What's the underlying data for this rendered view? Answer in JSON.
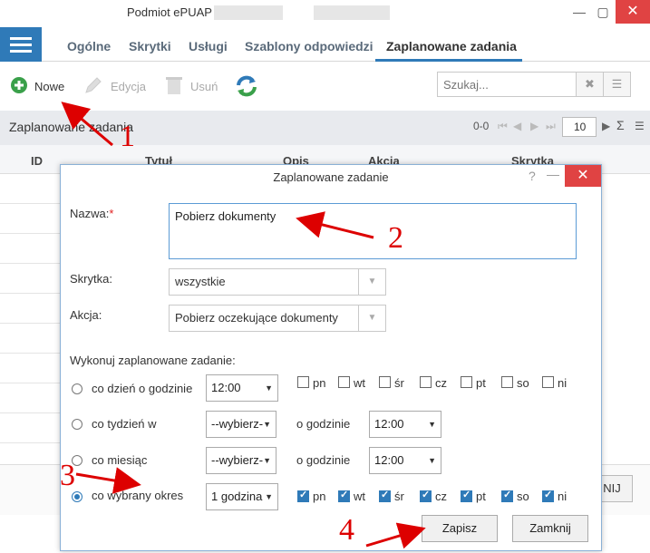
{
  "window": {
    "title": "Podmiot ePUAP -"
  },
  "tabs": [
    "Ogólne",
    "Skrytki",
    "Usługi",
    "Szablony odpowiedzi",
    "Zaplanowane zadania"
  ],
  "toolbar": {
    "new_label": "Nowe",
    "edit_label": "Edycja",
    "delete_label": "Usuń"
  },
  "search": {
    "placeholder": "Szukaj..."
  },
  "grid": {
    "title": "Zaplanowane zadania",
    "range": "0-0",
    "page_size": "10",
    "columns": [
      "ID",
      "Tytuł",
      "Opis",
      "Akcja",
      "Skrytka"
    ],
    "bottom_button": "NIJ"
  },
  "dialog": {
    "title": "Zaplanowane zadanie",
    "help": "?",
    "name_label": "Nazwa:",
    "required_mark": "*",
    "name_value": "Pobierz dokumenty",
    "box_label": "Skrytka:",
    "box_value": "wszystkie",
    "action_label": "Akcja:",
    "action_value": "Pobierz oczekujące dokumenty",
    "schedule_label": "Wykonuj zaplanowane zadanie:",
    "options": [
      {
        "label": "co dzień o godzinie",
        "value": "12:00",
        "selected": false
      },
      {
        "label": "co tydzień w",
        "value": "--wybierz-",
        "at_label": "o godzinie",
        "time": "12:00",
        "selected": false
      },
      {
        "label": "co miesiąc",
        "value": "--wybierz-",
        "at_label": "o godzinie",
        "time": "12:00",
        "selected": false
      },
      {
        "label": "co wybrany okres",
        "value": "1 godzina",
        "selected": true
      }
    ],
    "days": [
      "pn",
      "wt",
      "śr",
      "cz",
      "pt",
      "so",
      "ni"
    ],
    "daily_days_checked": [
      false,
      false,
      false,
      false,
      false,
      false,
      false
    ],
    "period_days_checked": [
      true,
      true,
      true,
      true,
      true,
      true,
      true
    ],
    "save_label": "Zapisz",
    "close_label": "Zamknij"
  },
  "annotations": [
    "1",
    "2",
    "3",
    "4"
  ],
  "colors": {
    "accent": "#2f7ab8",
    "close": "#e04343",
    "annotation": "#dd0000",
    "new_icon": "#3aa04a"
  }
}
